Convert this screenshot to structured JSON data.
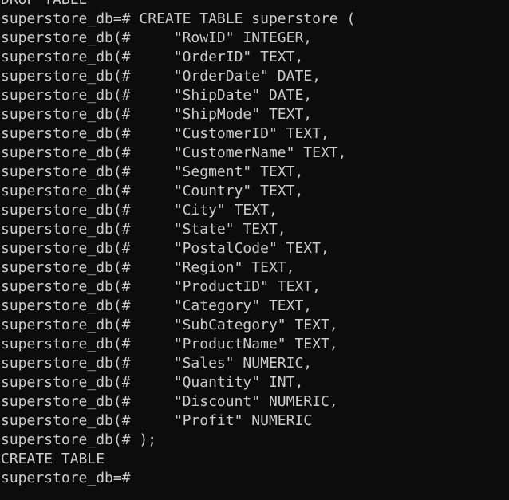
{
  "terminal": {
    "lines": [
      "DROP TABLE",
      "superstore_db=# CREATE TABLE superstore (",
      "superstore_db(#     \"RowID\" INTEGER,",
      "superstore_db(#     \"OrderID\" TEXT,",
      "superstore_db(#     \"OrderDate\" DATE,",
      "superstore_db(#     \"ShipDate\" DATE,",
      "superstore_db(#     \"ShipMode\" TEXT,",
      "superstore_db(#     \"CustomerID\" TEXT,",
      "superstore_db(#     \"CustomerName\" TEXT,",
      "superstore_db(#     \"Segment\" TEXT,",
      "superstore_db(#     \"Country\" TEXT,",
      "superstore_db(#     \"City\" TEXT,",
      "superstore_db(#     \"State\" TEXT,",
      "superstore_db(#     \"PostalCode\" TEXT,",
      "superstore_db(#     \"Region\" TEXT,",
      "superstore_db(#     \"ProductID\" TEXT,",
      "superstore_db(#     \"Category\" TEXT,",
      "superstore_db(#     \"SubCategory\" TEXT,",
      "superstore_db(#     \"ProductName\" TEXT,",
      "superstore_db(#     \"Sales\" NUMERIC,",
      "superstore_db(#     \"Quantity\" INT,",
      "superstore_db(#     \"Discount\" NUMERIC,",
      "superstore_db(#     \"Profit\" NUMERIC",
      "superstore_db(# );",
      "CREATE TABLE",
      "superstore_db=#"
    ]
  }
}
